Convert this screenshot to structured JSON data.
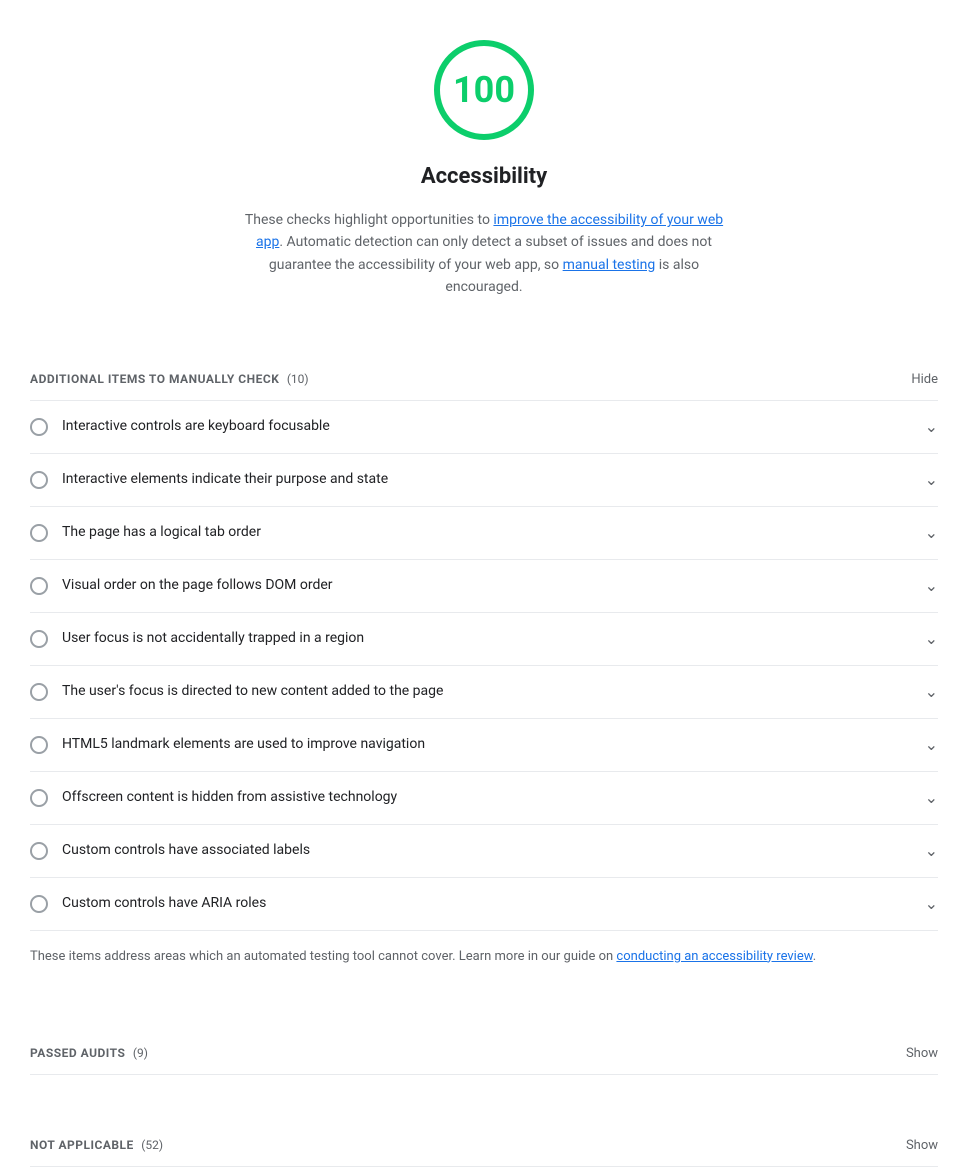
{
  "score": {
    "value": "100",
    "label": "Accessibility",
    "description_part1": "These checks highlight opportunities to ",
    "link1_text": "improve the accessibility of your web app",
    "description_part2": ". Automatic detection can only detect a subset of issues and does not guarantee the accessibility of your web app, so ",
    "link2_text": "manual testing",
    "description_part3": " is also encouraged."
  },
  "manual_section": {
    "title": "ADDITIONAL ITEMS TO MANUALLY CHECK",
    "count": "(10)",
    "toggle_label": "Hide"
  },
  "audit_items": [
    {
      "label": "Interactive controls are keyboard focusable"
    },
    {
      "label": "Interactive elements indicate their purpose and state"
    },
    {
      "label": "The page has a logical tab order"
    },
    {
      "label": "Visual order on the page follows DOM order"
    },
    {
      "label": "User focus is not accidentally trapped in a region"
    },
    {
      "label": "The user's focus is directed to new content added to the page"
    },
    {
      "label": "HTML5 landmark elements are used to improve navigation"
    },
    {
      "label": "Offscreen content is hidden from assistive technology"
    },
    {
      "label": "Custom controls have associated labels"
    },
    {
      "label": "Custom controls have ARIA roles"
    }
  ],
  "manual_note": {
    "text_before": "These items address areas which an automated testing tool cannot cover. Learn more in our guide on ",
    "link_text": "conducting an accessibility review",
    "text_after": "."
  },
  "passed_section": {
    "title": "PASSED AUDITS",
    "count": "(9)",
    "toggle_label": "Show"
  },
  "not_applicable_section": {
    "title": "NOT APPLICABLE",
    "count": "(52)",
    "toggle_label": "Show"
  },
  "chevron": "∨",
  "icons": {
    "chevron_down": "❯"
  }
}
